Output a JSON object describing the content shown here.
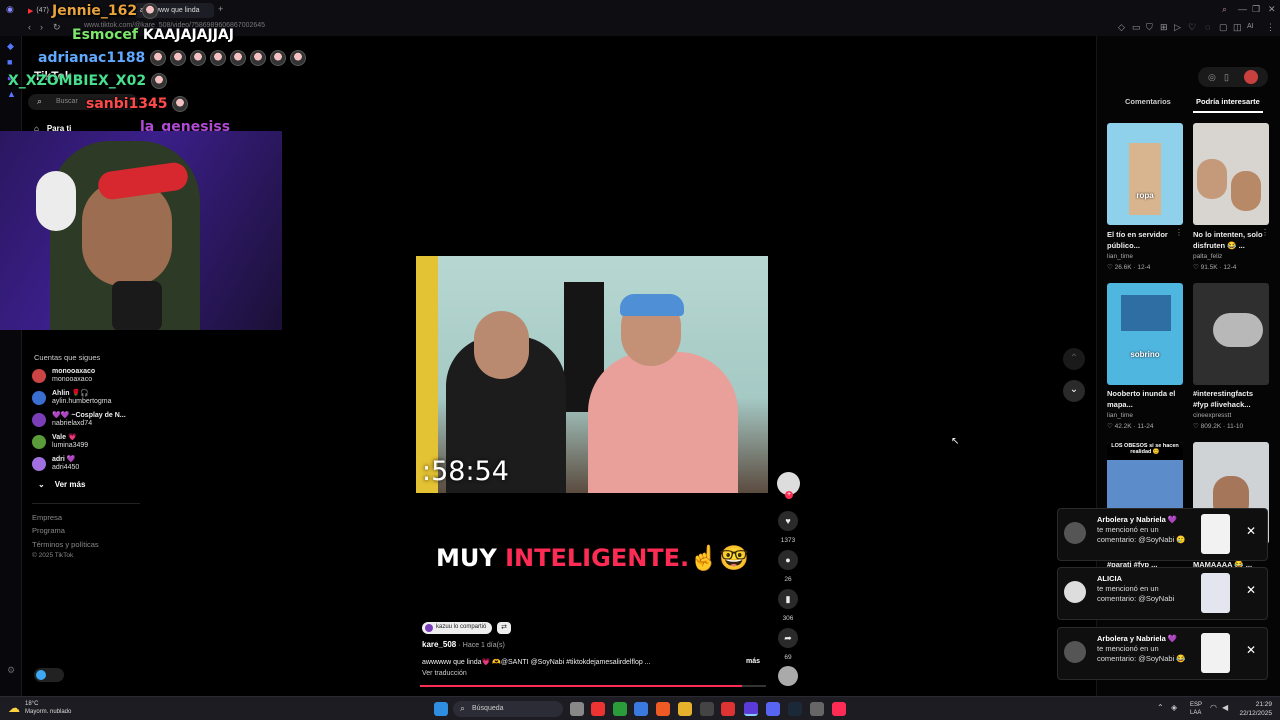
{
  "browser": {
    "tabs": [
      {
        "label": "(47) ",
        "active": false
      },
      {
        "label": "awwwww que linda",
        "active": true
      }
    ],
    "url": "www.tiktok.com/@kare_508/video/7586989606867002645",
    "right_tools": [
      "AI"
    ]
  },
  "chat": [
    {
      "user": "Jennie_162",
      "message": "",
      "color": "#e8a33d"
    },
    {
      "user": "Esmocef",
      "message": "KAAJAJAJJAJ",
      "color": "#7be76b"
    },
    {
      "user": "adrianac1188",
      "message": "",
      "color": "#5fa9ff"
    },
    {
      "user": "X_XZOMBIEX_X02",
      "message": "",
      "color": "#48e08c"
    },
    {
      "user": "sanbi1345",
      "message": "",
      "color": "#ff4a4a"
    },
    {
      "user": "la_genesiss",
      "message": "",
      "color": "#b14ad6"
    }
  ],
  "tiktok": {
    "logo": "TikTok",
    "search_placeholder": "Buscar",
    "nav_for_you": "Para ti",
    "following_title": "Cuentas que sigues",
    "accounts": [
      {
        "name": "monooaxaco",
        "handle": "monooaxaco",
        "color": "#c44"
      },
      {
        "name": "Ahlin 🌹🎧",
        "handle": "aylin.humbertogma",
        "color": "#3a6fd1"
      },
      {
        "name": "💜💜 ~Cosplay de N...",
        "handle": "nabrielaxd74",
        "color": "#7a3fb8"
      },
      {
        "name": "Vale 💗",
        "handle": "lumina3499",
        "color": "#5a9c3a"
      },
      {
        "name": "adri 💜",
        "handle": "adri4450",
        "color": "#a070e0"
      }
    ],
    "see_more": "Ver más",
    "footer": [
      "Empresa",
      "Programa",
      "Términos y políticas",
      "© 2025 TikTok"
    ]
  },
  "video": {
    "timer": ":58:54",
    "caption_part1": "MUY ",
    "caption_part2": "INTELIGENTE.",
    "caption_emoji": "☝️🤓",
    "shared_by": "kazuu lo compartió",
    "author": "kare_508",
    "posted": "· Hace 1 día(s)",
    "description": "awwwww que linda💗 🫶@SANTI @SoyNabi  #tiktokdejamesalirdelflop ...",
    "more": "más",
    "translate": "Ver traducción",
    "progress": 0.93
  },
  "actions": [
    {
      "icon": "heart-icon",
      "glyph": "♥",
      "count": "1373"
    },
    {
      "icon": "comment-icon",
      "glyph": "●",
      "count": "26"
    },
    {
      "icon": "bookmark-icon",
      "glyph": "▮",
      "count": "306"
    },
    {
      "icon": "share-icon",
      "glyph": "➦",
      "count": "69"
    }
  ],
  "right_panel": {
    "tab_comments": "Comentarios",
    "tab_related": "Podría interesarte",
    "cards": [
      {
        "thumb_text": "ropa",
        "title": "El tío en servidor público...",
        "author": "lian_time",
        "stats": "♡ 26.6K · 12-4",
        "bg": "#8fd0ea"
      },
      {
        "thumb_text": "",
        "title": "No lo intenten, solo disfruten 😂 ...",
        "author": "palta_feliz",
        "stats": "♡ 91.5K · 12-4",
        "bg": "#d8d4cf"
      },
      {
        "thumb_text": "sobrino",
        "title": "Nooberto inunda el mapa...",
        "author": "lian_time",
        "stats": "♡ 42.2K · 11-24",
        "bg": "#4fb6df"
      },
      {
        "thumb_text": "",
        "title": "#interestingfacts #fyp #livehack...",
        "author": "cineexpresstt",
        "stats": "♡ 809.2K · 11-10",
        "bg": "#2f2f2f"
      },
      {
        "thumb_text": "LOS OBESOS si se hacen realidad 😊",
        "title": "#parati #fyp ...",
        "author": "",
        "stats": "",
        "bg": "#5c8cc9"
      },
      {
        "thumb_text": "",
        "title": "MAMAAAA 😂 ...",
        "author": "",
        "stats": "",
        "bg": "#cfd3d6"
      }
    ]
  },
  "notifications": [
    {
      "name": "Arbolera y Nabriela 💜",
      "text": "te mencionó en un comentario: @SoyNabi 🥲"
    },
    {
      "name": "ALICIA",
      "text": "te mencionó en un comentario: @SoyNabi"
    },
    {
      "name": "Arbolera y Nabriela 💜",
      "text": "te mencionó en un comentario: @SoyNabi 😂"
    }
  ],
  "taskbar": {
    "weather_temp": "18°C",
    "weather_desc": "Mayorm. nublado",
    "search": "Búsqueda",
    "lang": "ESP",
    "lang2": "LAA",
    "time": "21:29",
    "date": "22/12/2025"
  }
}
